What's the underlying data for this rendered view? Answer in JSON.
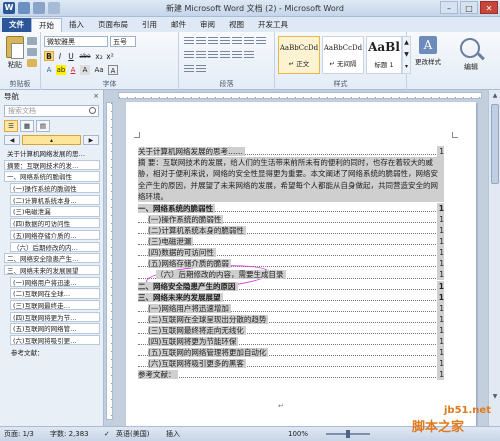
{
  "window": {
    "title": "新建 Microsoft Word 文档 (2) - Microsoft Word",
    "buttons": {
      "minimize": "–",
      "maximize": "□",
      "close": "✕"
    }
  },
  "tabs": [
    "文件",
    "开始",
    "插入",
    "页面布局",
    "引用",
    "邮件",
    "审阅",
    "视图",
    "开发工具"
  ],
  "ribbon": {
    "clipboard": {
      "paste": "粘贴",
      "label": "剪贴板"
    },
    "font": {
      "name": "微软雅黑",
      "size": "五号",
      "label": "字体",
      "buttons": [
        "B",
        "I",
        "U",
        "abe",
        "x₂",
        "x²"
      ],
      "row3": [
        "A",
        "ab",
        "A",
        "A",
        "Aa",
        "A"
      ]
    },
    "paragraph": {
      "label": "段落"
    },
    "styles": {
      "label": "样式",
      "cards": [
        {
          "sample": "AaBbCcDd",
          "name": "↵ 正文"
        },
        {
          "sample": "AaBbCcDd",
          "name": "↵ 无间隔"
        },
        {
          "sample": "AaBl",
          "name": "标题 1"
        }
      ],
      "change": "更改样式"
    },
    "editing": {
      "label": "编辑"
    }
  },
  "nav": {
    "title": "导航",
    "close": "×",
    "search_placeholder": "搜索文档",
    "view_buttons": [
      "☰",
      "▦",
      "▤"
    ],
    "items": [
      {
        "label": "关于计算机网络发展的思…",
        "level": "top"
      },
      {
        "label": "摘要：互联网技术的发…",
        "level": "l1"
      },
      {
        "label": "一、网络系统的脆弱性",
        "level": "l1"
      },
      {
        "label": "(一)操作系统的脆弱性",
        "level": "l2"
      },
      {
        "label": "(二)计算机系统本身…",
        "level": "l2"
      },
      {
        "label": "(三)电磁泄漏",
        "level": "l2"
      },
      {
        "label": "(四)数据的可访问性",
        "level": "l2"
      },
      {
        "label": "(五)网络存储介质的…",
        "level": "l2"
      },
      {
        "label": "（六）后期修改的内…",
        "level": "l2"
      },
      {
        "label": "二、网络安全隐患产生…",
        "level": "l1"
      },
      {
        "label": "三、网络未来的发展展望",
        "level": "l1"
      },
      {
        "label": "(一)网络用户将迅速…",
        "level": "l2"
      },
      {
        "label": "(二)互联网在全球…",
        "level": "l2"
      },
      {
        "label": "(三)互联网最终走…",
        "level": "l2"
      },
      {
        "label": "(四)互联网将更为节…",
        "level": "l2"
      },
      {
        "label": "(五)互联网的网络管…",
        "level": "l2"
      },
      {
        "label": "(六)互联网将吸引更…",
        "level": "l2"
      },
      {
        "label": "参考文献：",
        "level": "plain"
      }
    ]
  },
  "document": {
    "toc": [
      {
        "text": "关于计算机网络发展的思考……",
        "page": "1",
        "style": "plain",
        "indent": 0
      },
      {
        "text": "摘 要：互联网技术的发展，给人们的生活带来前所未有的便利的同时，也存在着较大的威胁，相对于便利来说，网络的安全性显得更为重要。本文阐述了网络系统的脆弱性，网络安全产生的原因，并展望了未来网络的发展，希望每个人都能从自身做起，共同营造安全的网络环境。",
        "page": "1",
        "style": "para",
        "indent": 0
      },
      {
        "text": "一、网络系统的脆弱性",
        "page": "1",
        "style": "b",
        "indent": 0
      },
      {
        "text": "(一)操作系统的脆弱性",
        "page": "1",
        "style": "plain",
        "indent": 1
      },
      {
        "text": "(二)计算机系统本身的脆弱性",
        "page": "1",
        "style": "plain",
        "indent": 1
      },
      {
        "text": "(三)电磁泄漏",
        "page": "1",
        "style": "plain",
        "indent": 1
      },
      {
        "text": "(四)数据的可访问性",
        "page": "1",
        "style": "plain",
        "indent": 1
      },
      {
        "text": "(五)网络存储介质的脆弱",
        "page": "1",
        "style": "plain",
        "indent": 1
      },
      {
        "text": "（六）后期修改的内容，需要生成目录",
        "page": "1",
        "style": "plain",
        "indent": 2
      },
      {
        "text": "二、网络安全隐患产生的原因",
        "page": "1",
        "style": "b",
        "indent": 0
      },
      {
        "text": "三、网络未来的发展展望",
        "page": "1",
        "style": "b",
        "indent": 0
      },
      {
        "text": "(一)网络用户将迅速增加",
        "page": "1",
        "style": "plain",
        "indent": 1
      },
      {
        "text": "(二)互联网在全球呈现出分散的趋势",
        "page": "1",
        "style": "plain",
        "indent": 1
      },
      {
        "text": "(三)互联网最终将走向无线化",
        "page": "1",
        "style": "plain",
        "indent": 1
      },
      {
        "text": "(四)互联网将更为节能环保",
        "page": "1",
        "style": "plain",
        "indent": 1
      },
      {
        "text": "(五)互联网的网络管理将更加自动化",
        "page": "1",
        "style": "plain",
        "indent": 1
      },
      {
        "text": "(六)互联网将吸引更多的黑客",
        "page": "1",
        "style": "plain",
        "indent": 1
      },
      {
        "text": "参考文献：",
        "page": "1",
        "style": "plain",
        "indent": 0
      }
    ]
  },
  "status": {
    "page": "页面: 1/3",
    "words": "字数: 2,383",
    "lang": "英语(美国)",
    "mode": "插入",
    "zoom": "100%"
  },
  "watermark": {
    "site": "jb51.net",
    "name": "脚本之家"
  }
}
